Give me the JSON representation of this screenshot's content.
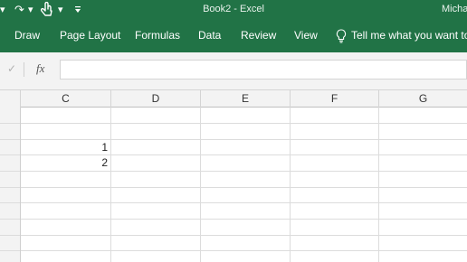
{
  "window": {
    "title": "Book2  -  Excel",
    "user": "Micha"
  },
  "ribbon": {
    "tabs": [
      "Draw",
      "Page Layout",
      "Formulas",
      "Data",
      "Review",
      "View"
    ],
    "tell_me": "Tell me what you want to d"
  },
  "formula_bar": {
    "fx_label": "fx",
    "value": ""
  },
  "sheet": {
    "columns": [
      "C",
      "D",
      "E",
      "F",
      "G"
    ],
    "cells": [
      {
        "ref": "C2",
        "value": "1"
      },
      {
        "ref": "C3",
        "value": "2"
      }
    ]
  },
  "colors": {
    "accent": "#217346"
  }
}
